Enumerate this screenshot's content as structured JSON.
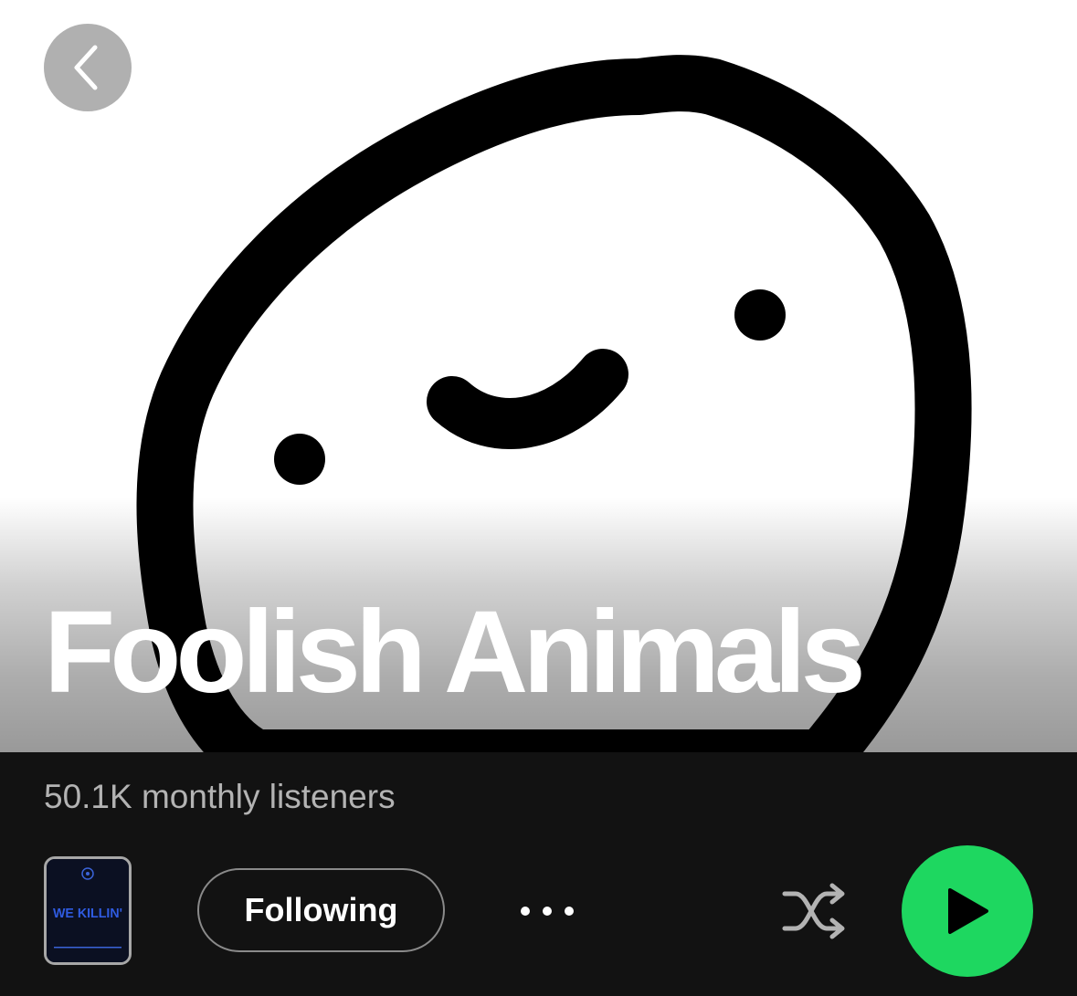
{
  "artist": {
    "name": "Foolish Animals",
    "monthly_listeners": "50.1K monthly listeners"
  },
  "actions": {
    "follow_label": "Following",
    "more_icon": "more-options-icon",
    "shuffle_icon": "shuffle-icon",
    "play_icon": "play-icon",
    "back_icon": "back-arrow-icon"
  },
  "release_thumbnail": {
    "text": "WE KILLIN'"
  },
  "colors": {
    "background": "#121212",
    "play_button": "#1ed760",
    "secondary_text": "#b3b3b3"
  }
}
